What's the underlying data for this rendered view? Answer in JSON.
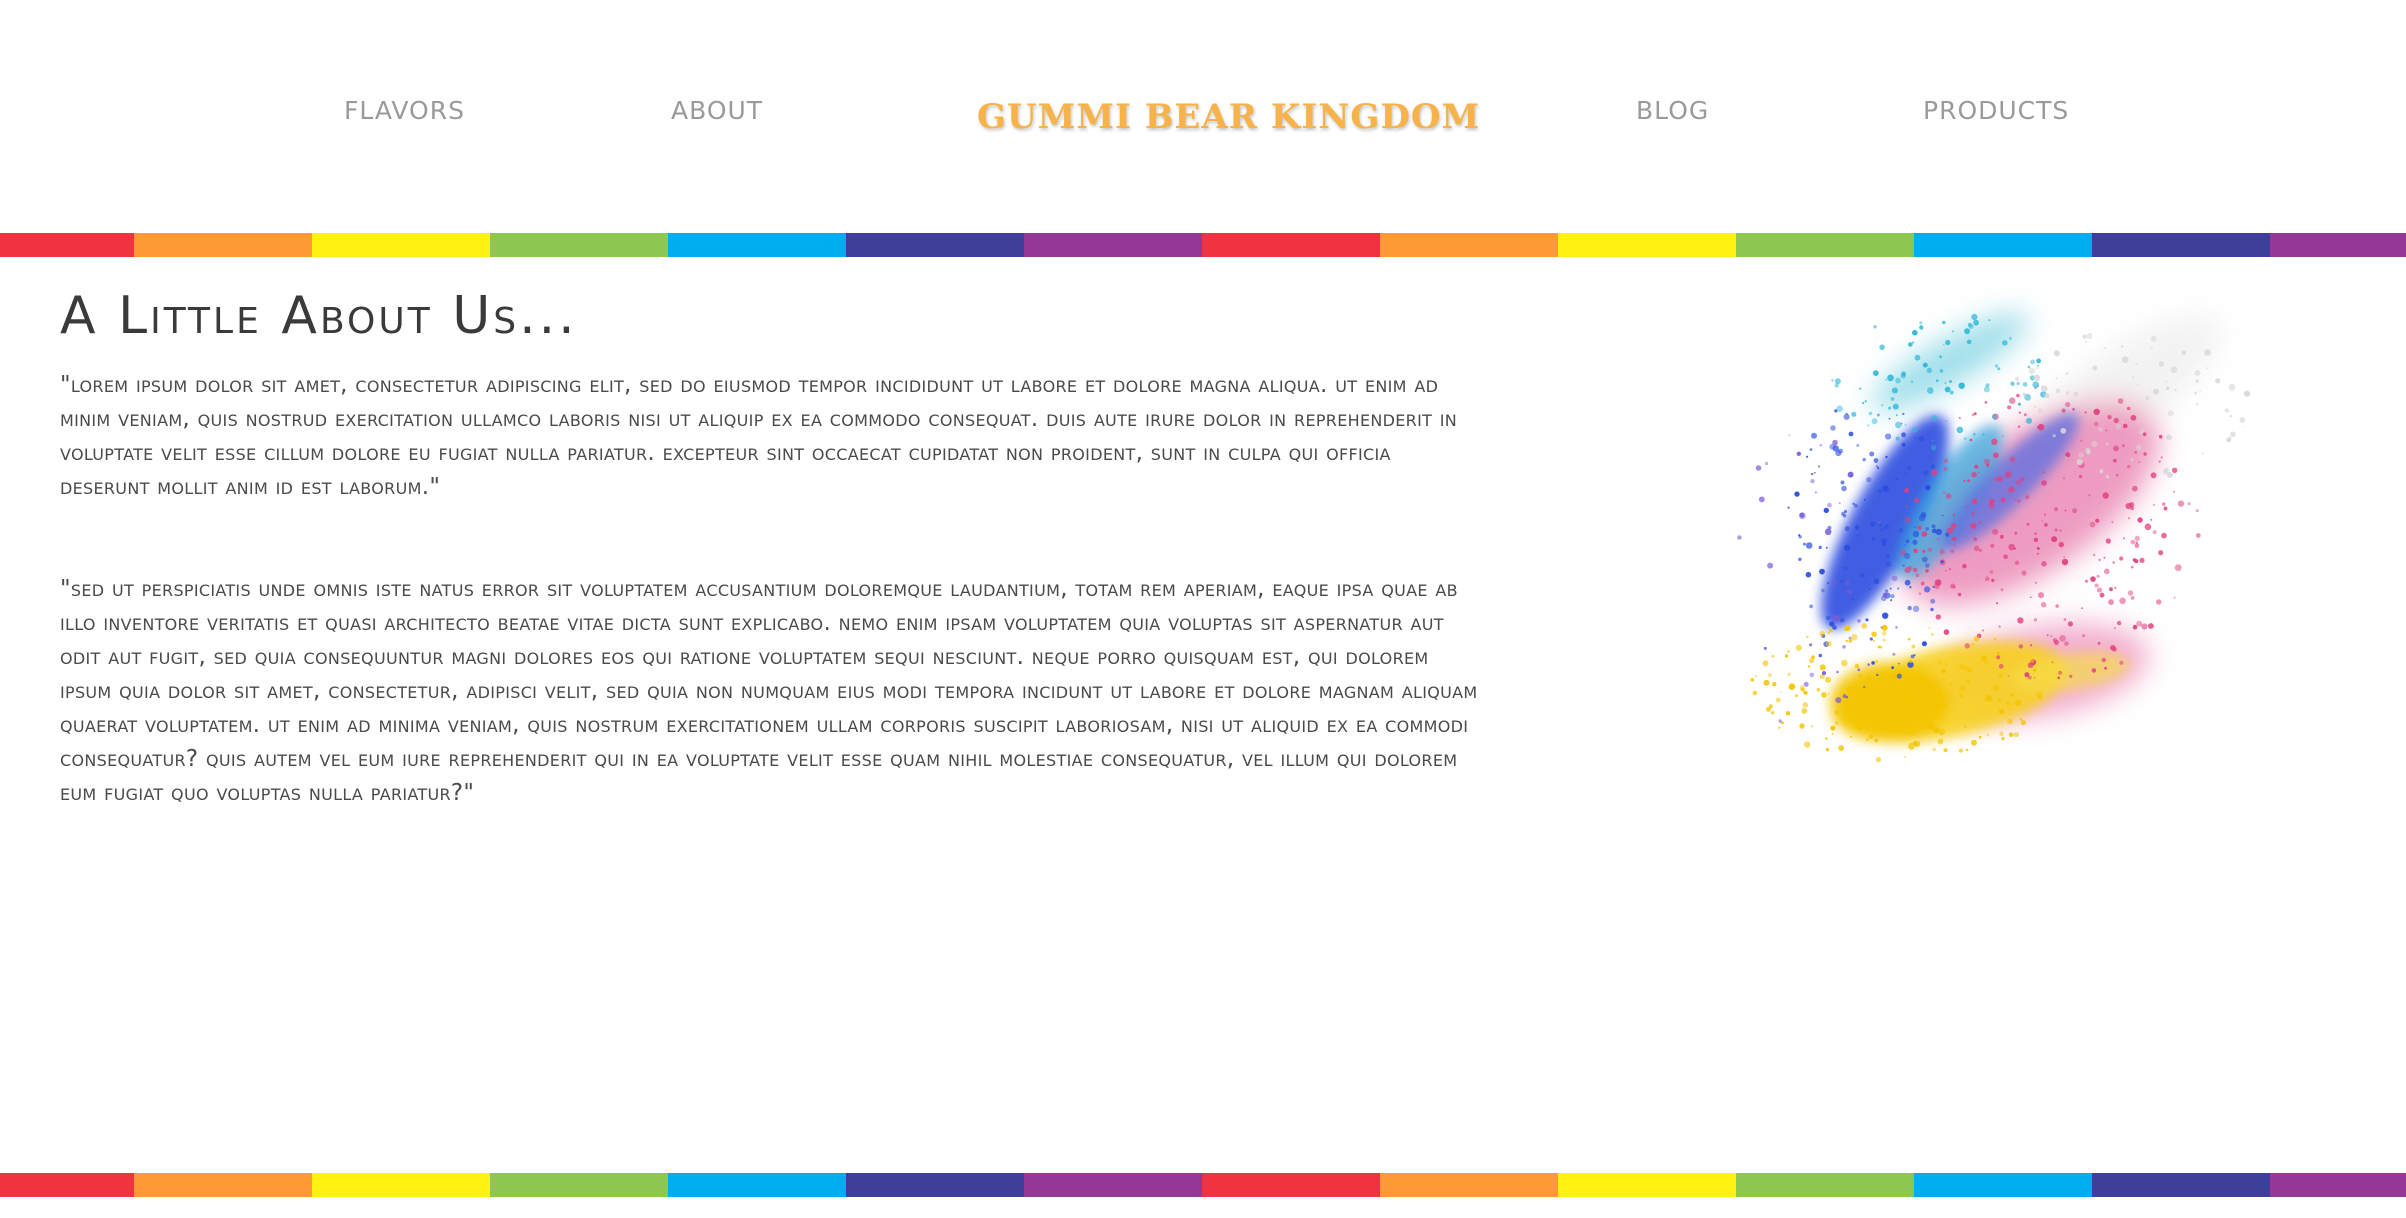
{
  "nav": {
    "flavors_label": "FLAVORS",
    "about_label": "ABOUT",
    "brand": "GUMMI BEAR KINGDOM",
    "blog_label": "BLOG",
    "products_label": "PRODUCTS"
  },
  "colors": {
    "brand": "#f7b24a",
    "nav_text": "#9a9a9a",
    "heading_text": "#3a3a3a",
    "body_text": "#4a4a4a",
    "stripe": [
      "#ef3340",
      "#fd9a35",
      "#fff212",
      "#8dc74f",
      "#00aeef",
      "#3f3f9b",
      "#943896"
    ]
  },
  "content": {
    "title": "A Little About Us...",
    "paragraph_1": "\"Lorem ipsum dolor sit amet, consectetur adipiscing elit, sed do eiusmod tempor incididunt ut labore et dolore magna aliqua. Ut enim ad minim veniam, quis nostrud exercitation ullamco laboris nisi ut aliquip ex ea commodo consequat. Duis aute irure dolor in reprehenderit in voluptate velit esse cillum dolore eu fugiat nulla pariatur. Excepteur sint occaecat cupidatat non proident, sunt in culpa qui officia deserunt mollit anim id est laborum.\"",
    "paragraph_2": "\"Sed ut perspiciatis unde omnis iste natus error sit voluptatem accusantium doloremque laudantium, totam rem aperiam, eaque ipsa quae ab illo inventore veritatis et quasi architecto beatae vitae dicta sunt explicabo. Nemo enim ipsam voluptatem quia voluptas sit aspernatur aut odit aut fugit, sed quia consequuntur magni dolores eos qui ratione voluptatem sequi nesciunt. Neque porro quisquam est, qui dolorem ipsum quia dolor sit amet, consectetur, adipisci velit, sed quia non numquam eius modi tempora incidunt ut labore et dolore magnam aliquam quaerat voluptatem. Ut enim ad minima veniam, quis nostrum exercitationem ullam corporis suscipit laboriosam, nisi ut aliquid ex ea commodi consequatur? Quis autem vel eum iure reprehenderit qui in ea voluptate velit esse quam nihil molestiae consequatur, vel illum qui dolorem eum fugiat quo voluptas nulla pariatur?\"",
    "image_icon": "color-powder-splash-icon"
  }
}
